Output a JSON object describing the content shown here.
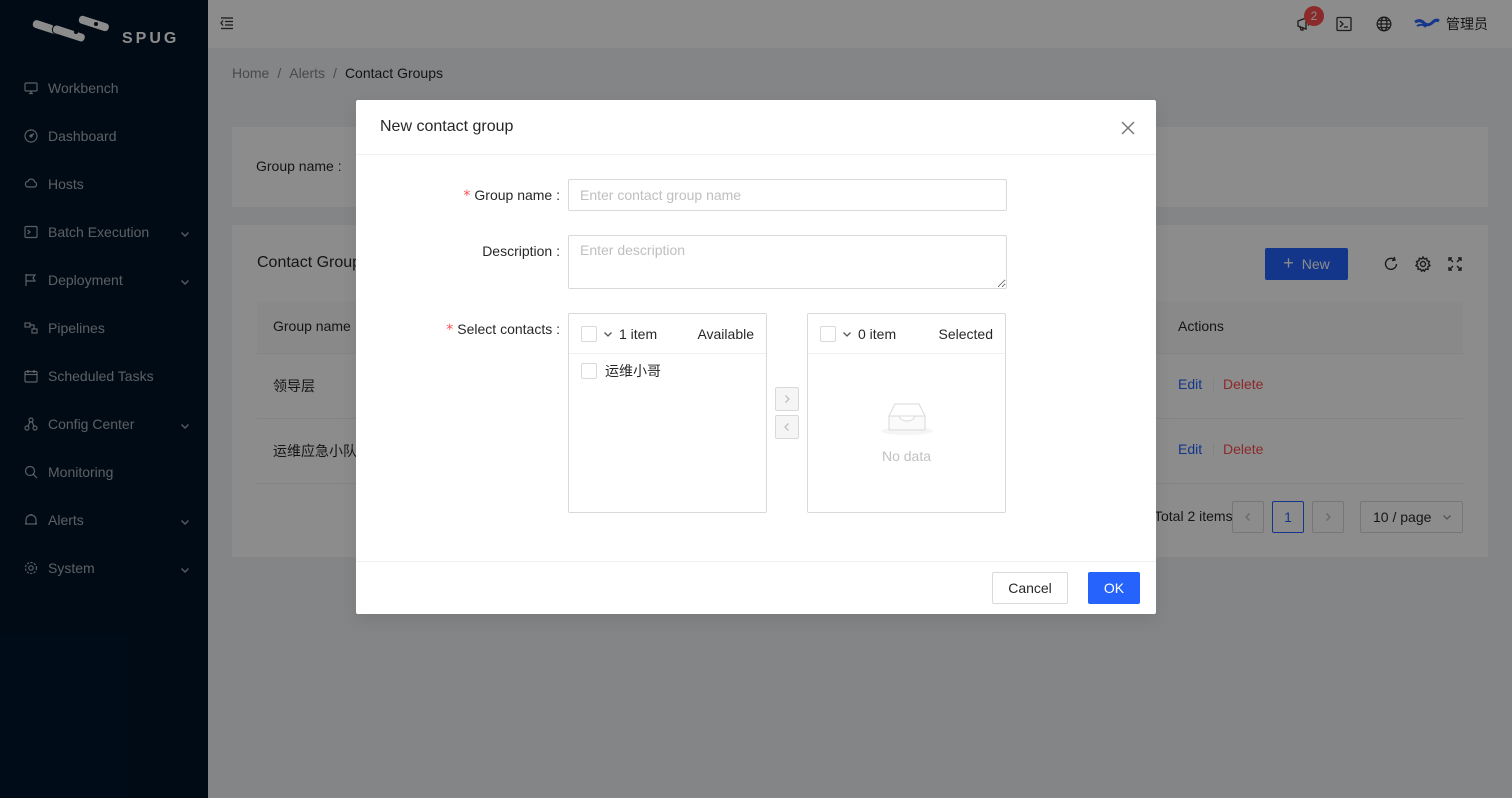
{
  "app": {
    "logo_text": "SPUG",
    "accent_color": "#2563fc",
    "danger_color": "#ff4d4f"
  },
  "sidebar": {
    "items": [
      {
        "label": "Workbench",
        "icon": "desktop-icon",
        "has_submenu": false
      },
      {
        "label": "Dashboard",
        "icon": "dashboard-icon",
        "has_submenu": false
      },
      {
        "label": "Hosts",
        "icon": "cloud-server-icon",
        "has_submenu": false
      },
      {
        "label": "Batch Execution",
        "icon": "terminal-icon",
        "has_submenu": true
      },
      {
        "label": "Deployment",
        "icon": "flag-icon",
        "has_submenu": true
      },
      {
        "label": "Pipelines",
        "icon": "pipeline-icon",
        "has_submenu": false
      },
      {
        "label": "Scheduled Tasks",
        "icon": "schedule-icon",
        "has_submenu": false
      },
      {
        "label": "Config Center",
        "icon": "deployment-unit-icon",
        "has_submenu": true
      },
      {
        "label": "Monitoring",
        "icon": "monitor-icon",
        "has_submenu": false
      },
      {
        "label": "Alerts",
        "icon": "alert-icon",
        "has_submenu": true
      },
      {
        "label": "System",
        "icon": "setting-icon",
        "has_submenu": true
      }
    ]
  },
  "header": {
    "notification_count": "2",
    "user_name": "管理员"
  },
  "breadcrumb": {
    "items": [
      "Home",
      "Alerts",
      "Contact Groups"
    ],
    "separator": "/"
  },
  "search": {
    "label": "Group name"
  },
  "table": {
    "title": "Contact Groups",
    "new_button": "New",
    "columns": {
      "name": "Group name",
      "actions": "Actions"
    },
    "rows": [
      {
        "name": "领导层",
        "edit": "Edit",
        "delete": "Delete"
      },
      {
        "name": "运维应急小队",
        "edit": "Edit",
        "delete": "Delete"
      }
    ],
    "pagination": {
      "total_text": "Total 2 items",
      "current_page": "1",
      "page_size": "10 / page"
    }
  },
  "modal": {
    "title": "New contact group",
    "fields": {
      "group_name": {
        "label": "Group name",
        "placeholder": "Enter contact group name",
        "value": ""
      },
      "description": {
        "label": "Description",
        "placeholder": "Enter description",
        "value": ""
      },
      "contacts": {
        "label": "Select contacts"
      }
    },
    "transfer": {
      "source": {
        "count": "1 item",
        "title": "Available",
        "items": [
          "运维小哥"
        ]
      },
      "target": {
        "count": "0 item",
        "title": "Selected",
        "empty_text": "No data"
      }
    },
    "footer": {
      "cancel": "Cancel",
      "ok": "OK"
    }
  }
}
